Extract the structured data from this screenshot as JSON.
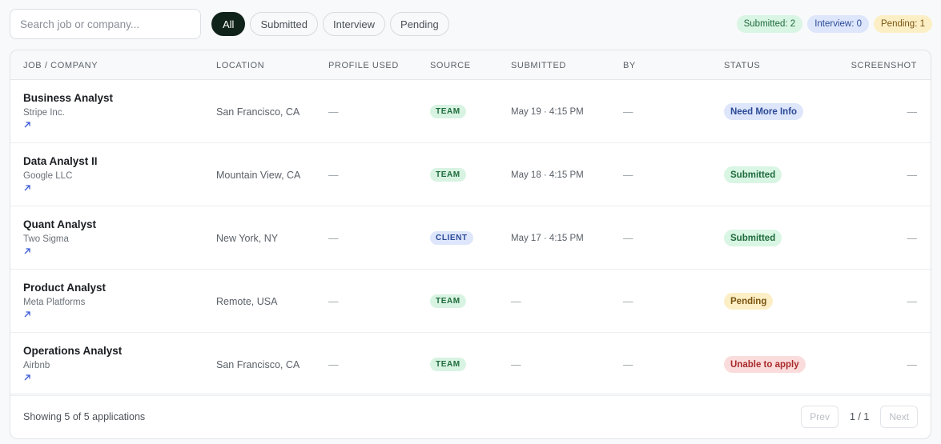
{
  "search": {
    "placeholder": "Search job or company..."
  },
  "filters": [
    {
      "label": "All",
      "active": true
    },
    {
      "label": "Submitted",
      "active": false
    },
    {
      "label": "Interview",
      "active": false
    },
    {
      "label": "Pending",
      "active": false
    }
  ],
  "counters": {
    "submitted": "Submitted: 2",
    "interview": "Interview: 0",
    "pending": "Pending: 1"
  },
  "columns": {
    "job": "JOB / COMPANY",
    "location": "LOCATION",
    "profile": "PROFILE USED",
    "source": "SOURCE",
    "submitted": "SUBMITTED",
    "by": "BY",
    "status": "STATUS",
    "screenshot": "SCREENSHOT"
  },
  "rows": [
    {
      "title": "Business Analyst",
      "company": "Stripe Inc.",
      "location": "San Francisco, CA",
      "profile": "—",
      "source": "TEAM",
      "submitted": "May 19 · 4:15 PM",
      "by": "—",
      "status": "Need More Info",
      "screenshot": "—"
    },
    {
      "title": "Data Analyst II",
      "company": "Google LLC",
      "location": "Mountain View, CA",
      "profile": "—",
      "source": "TEAM",
      "submitted": "May 18 · 4:15 PM",
      "by": "—",
      "status": "Submitted",
      "screenshot": "—"
    },
    {
      "title": "Quant Analyst",
      "company": "Two Sigma",
      "location": "New York, NY",
      "profile": "—",
      "source": "CLIENT",
      "submitted": "May 17 · 4:15 PM",
      "by": "—",
      "status": "Submitted",
      "screenshot": "—"
    },
    {
      "title": "Product Analyst",
      "company": "Meta Platforms",
      "location": "Remote, USA",
      "profile": "—",
      "source": "TEAM",
      "submitted": "—",
      "by": "—",
      "status": "Pending",
      "screenshot": "—"
    },
    {
      "title": "Operations Analyst",
      "company": "Airbnb",
      "location": "San Francisco, CA",
      "profile": "—",
      "source": "TEAM",
      "submitted": "—",
      "by": "—",
      "status": "Unable to apply",
      "screenshot": "—"
    }
  ],
  "footer": {
    "showing": "Showing 5 of 5 applications",
    "prev": "Prev",
    "page": "1 / 1",
    "next": "Next"
  },
  "colors": {
    "accent": "#10231a",
    "link_icon": "#3b5bd6"
  }
}
